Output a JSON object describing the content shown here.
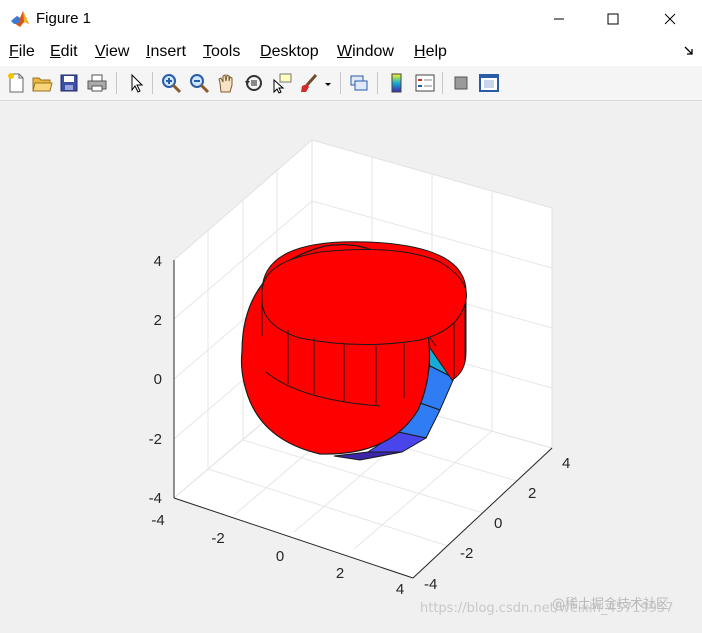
{
  "window": {
    "title": "Figure 1",
    "app_icon": "matlab-icon",
    "controls": [
      "minimize-icon",
      "maximize-icon",
      "close-icon"
    ]
  },
  "menubar": {
    "items": [
      {
        "label": "File",
        "accel": "F",
        "rest": "ile"
      },
      {
        "label": "Edit",
        "accel": "E",
        "rest": "dit"
      },
      {
        "label": "View",
        "accel": "V",
        "rest": "iew"
      },
      {
        "label": "Insert",
        "accel": "I",
        "rest": "nsert"
      },
      {
        "label": "Tools",
        "accel": "T",
        "rest": "ools"
      },
      {
        "label": "Desktop",
        "accel": "D",
        "rest": "esktop"
      },
      {
        "label": "Window",
        "accel": "W",
        "rest": "indow"
      },
      {
        "label": "Help",
        "accel": "H",
        "rest": "elp"
      }
    ]
  },
  "toolbar": {
    "icons": [
      "new-figure-icon",
      "open-file-icon",
      "save-icon",
      "print-icon",
      "select-arrow-icon",
      "zoom-in-icon",
      "zoom-out-icon",
      "pan-hand-icon",
      "rotate-3d-icon",
      "data-cursor-icon",
      "brush-icon",
      "brush-dropdown-icon",
      "link-plot-icon",
      "colorbar-icon",
      "legend-icon",
      "hide-plot-tools-icon",
      "show-plot-tools-icon"
    ]
  },
  "axes": {
    "z_ticks": [
      "4",
      "2",
      "0",
      "-2",
      "-4"
    ],
    "x_ticks": [
      "-4",
      "-2",
      "0",
      "2",
      "4"
    ],
    "y_ticks": [
      "-4",
      "-2",
      "0",
      "2",
      "4"
    ],
    "zlim": [
      -4,
      4
    ],
    "xlim": [
      -4,
      4
    ],
    "ylim": [
      -4,
      4
    ],
    "grid": true
  },
  "surface": {
    "sphere_color": "#ff0000",
    "cylinder_color": "#ff0000",
    "colormap": [
      "#3e26a8",
      "#4a45ea",
      "#2f7cf5",
      "#17acd6",
      "#1bbfa7",
      "#5bc863",
      "#a8bf3a",
      "#e6b533",
      "#fbcd2c",
      "#f9fb14"
    ]
  },
  "watermark": {
    "url": "https://blog.csdn.net/weixin_45719957",
    "label": "@稀土掘金技术社区"
  }
}
